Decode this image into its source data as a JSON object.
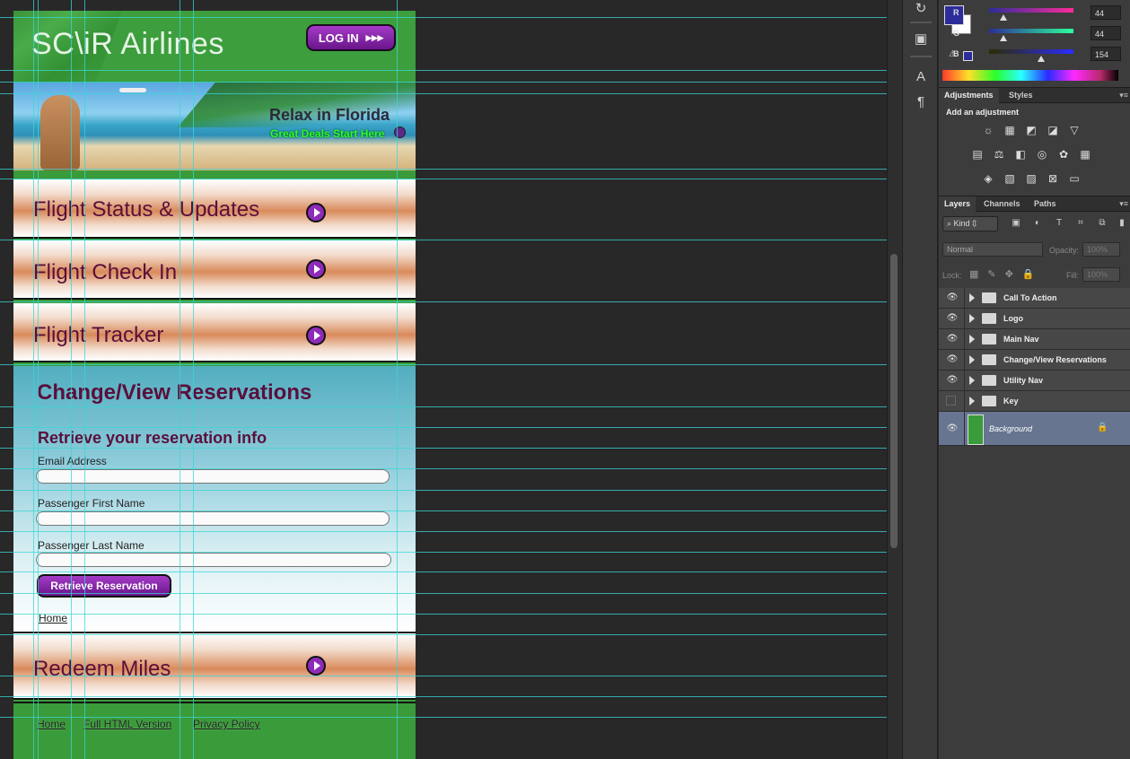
{
  "site": {
    "logo": "SC\\iR Airlines",
    "login_label": "LOG IN",
    "login_arrows": "▸▸▸",
    "banner_title": "Relax in Florida",
    "banner_sub": "Great Deals Start Here",
    "nav": [
      {
        "label": "Flight Status & Updates"
      },
      {
        "label": "Flight Check In"
      },
      {
        "label": "Flight Tracker"
      },
      {
        "label": "Redeem Miles"
      }
    ],
    "reservation": {
      "heading": "Change/View Reservations",
      "subheading": "Retrieve your reservation info",
      "fields": [
        {
          "label": "Email Address",
          "value": ""
        },
        {
          "label": "Passenger First Name",
          "value": ""
        },
        {
          "label": "Passenger Last Name",
          "value": ""
        }
      ],
      "button": "Retrieve Reservation",
      "home_link": "Home"
    },
    "footer": [
      "Home",
      "Full HTML Version",
      "Privacy Policy"
    ]
  },
  "color_panel": {
    "channels": [
      {
        "label": "R",
        "value": "44"
      },
      {
        "label": "G",
        "value": "44"
      },
      {
        "label": "B",
        "value": "154"
      }
    ],
    "foreground": "#2c2c9a"
  },
  "adjust_tabs": [
    "Adjustments",
    "Styles"
  ],
  "adjust_title": "Add an adjustment",
  "layer_tabs": [
    "Layers",
    "Channels",
    "Paths"
  ],
  "kind_label": "Kind",
  "blend_mode": "Normal",
  "opacity_label": "Opacity:",
  "opacity_value": "100%",
  "lock_label": "Lock:",
  "fill_label": "Fill:",
  "fill_value": "100%",
  "layers": [
    {
      "name": "Call To Action",
      "visible": true
    },
    {
      "name": "Logo",
      "visible": true
    },
    {
      "name": "Main Nav",
      "visible": true
    },
    {
      "name": "Change/View Reservations",
      "visible": true
    },
    {
      "name": "Utility Nav",
      "visible": true
    },
    {
      "name": "Key",
      "visible": false
    }
  ],
  "background_layer": "Background"
}
